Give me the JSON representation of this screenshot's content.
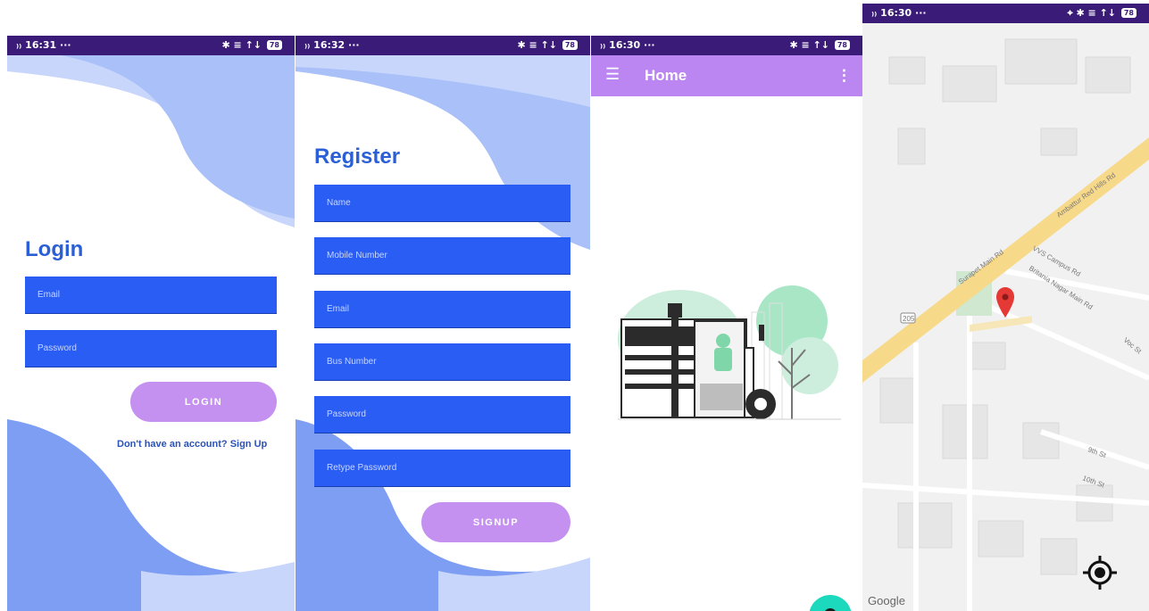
{
  "status_bars": [
    {
      "left": "₎₎ 16:31 ···",
      "right": "✱ ≡ ↑↓",
      "battery": "78"
    },
    {
      "left": "₎₎ 16:32 ···",
      "right": "✱ ≡ ↑↓",
      "battery": "78"
    },
    {
      "left": "₎₎ 16:30 ···",
      "right": "✱ ≡ ↑↓",
      "battery": "78"
    },
    {
      "left": "₎₎ 16:30 ···",
      "right": "⌖ ✱ ≡ ↑↓",
      "battery": "78"
    }
  ],
  "login": {
    "title": "Login",
    "email_placeholder": "Email",
    "password_placeholder": "Password",
    "login_button": "LOGIN",
    "signup_link": "Don't have an account? Sign Up"
  },
  "register": {
    "title": "Register",
    "fields": [
      "Name",
      "Mobile Number",
      "Email",
      "Bus Number",
      "Password",
      "Retype Password"
    ],
    "signup_button": "SIGNUP"
  },
  "home": {
    "menu_icon": "hamburger-icon",
    "title": "Home",
    "more_icon": "more-vertical-icon",
    "fab_icon": "location-pin-icon"
  },
  "map": {
    "labels": {
      "main_road": "Ambattur Red Hills Rd",
      "surapet": "Surapet Main Rd",
      "vvs": "VVS Campus Rd",
      "britania": "Britania Nagar Main Rd",
      "voc": "Voc St",
      "ninth": "9th St",
      "tenth": "10th St",
      "shield": "205"
    },
    "google_text": "Google",
    "locate_icon": "my-location-icon",
    "marker_icon": "map-marker-icon",
    "colors": {
      "road": "#f7d98a",
      "marker": "#e53935",
      "park": "#cfe8cf"
    }
  },
  "colors": {
    "status_bar": "#3a1b78",
    "field": "#2a5df4",
    "title": "#2a5fd6",
    "button": "#c591f0",
    "appbar": "#bb86f2",
    "fab": "#1cd9bd",
    "wave_dark": "#7e9ef4",
    "wave_light": "#c8d6fb"
  }
}
